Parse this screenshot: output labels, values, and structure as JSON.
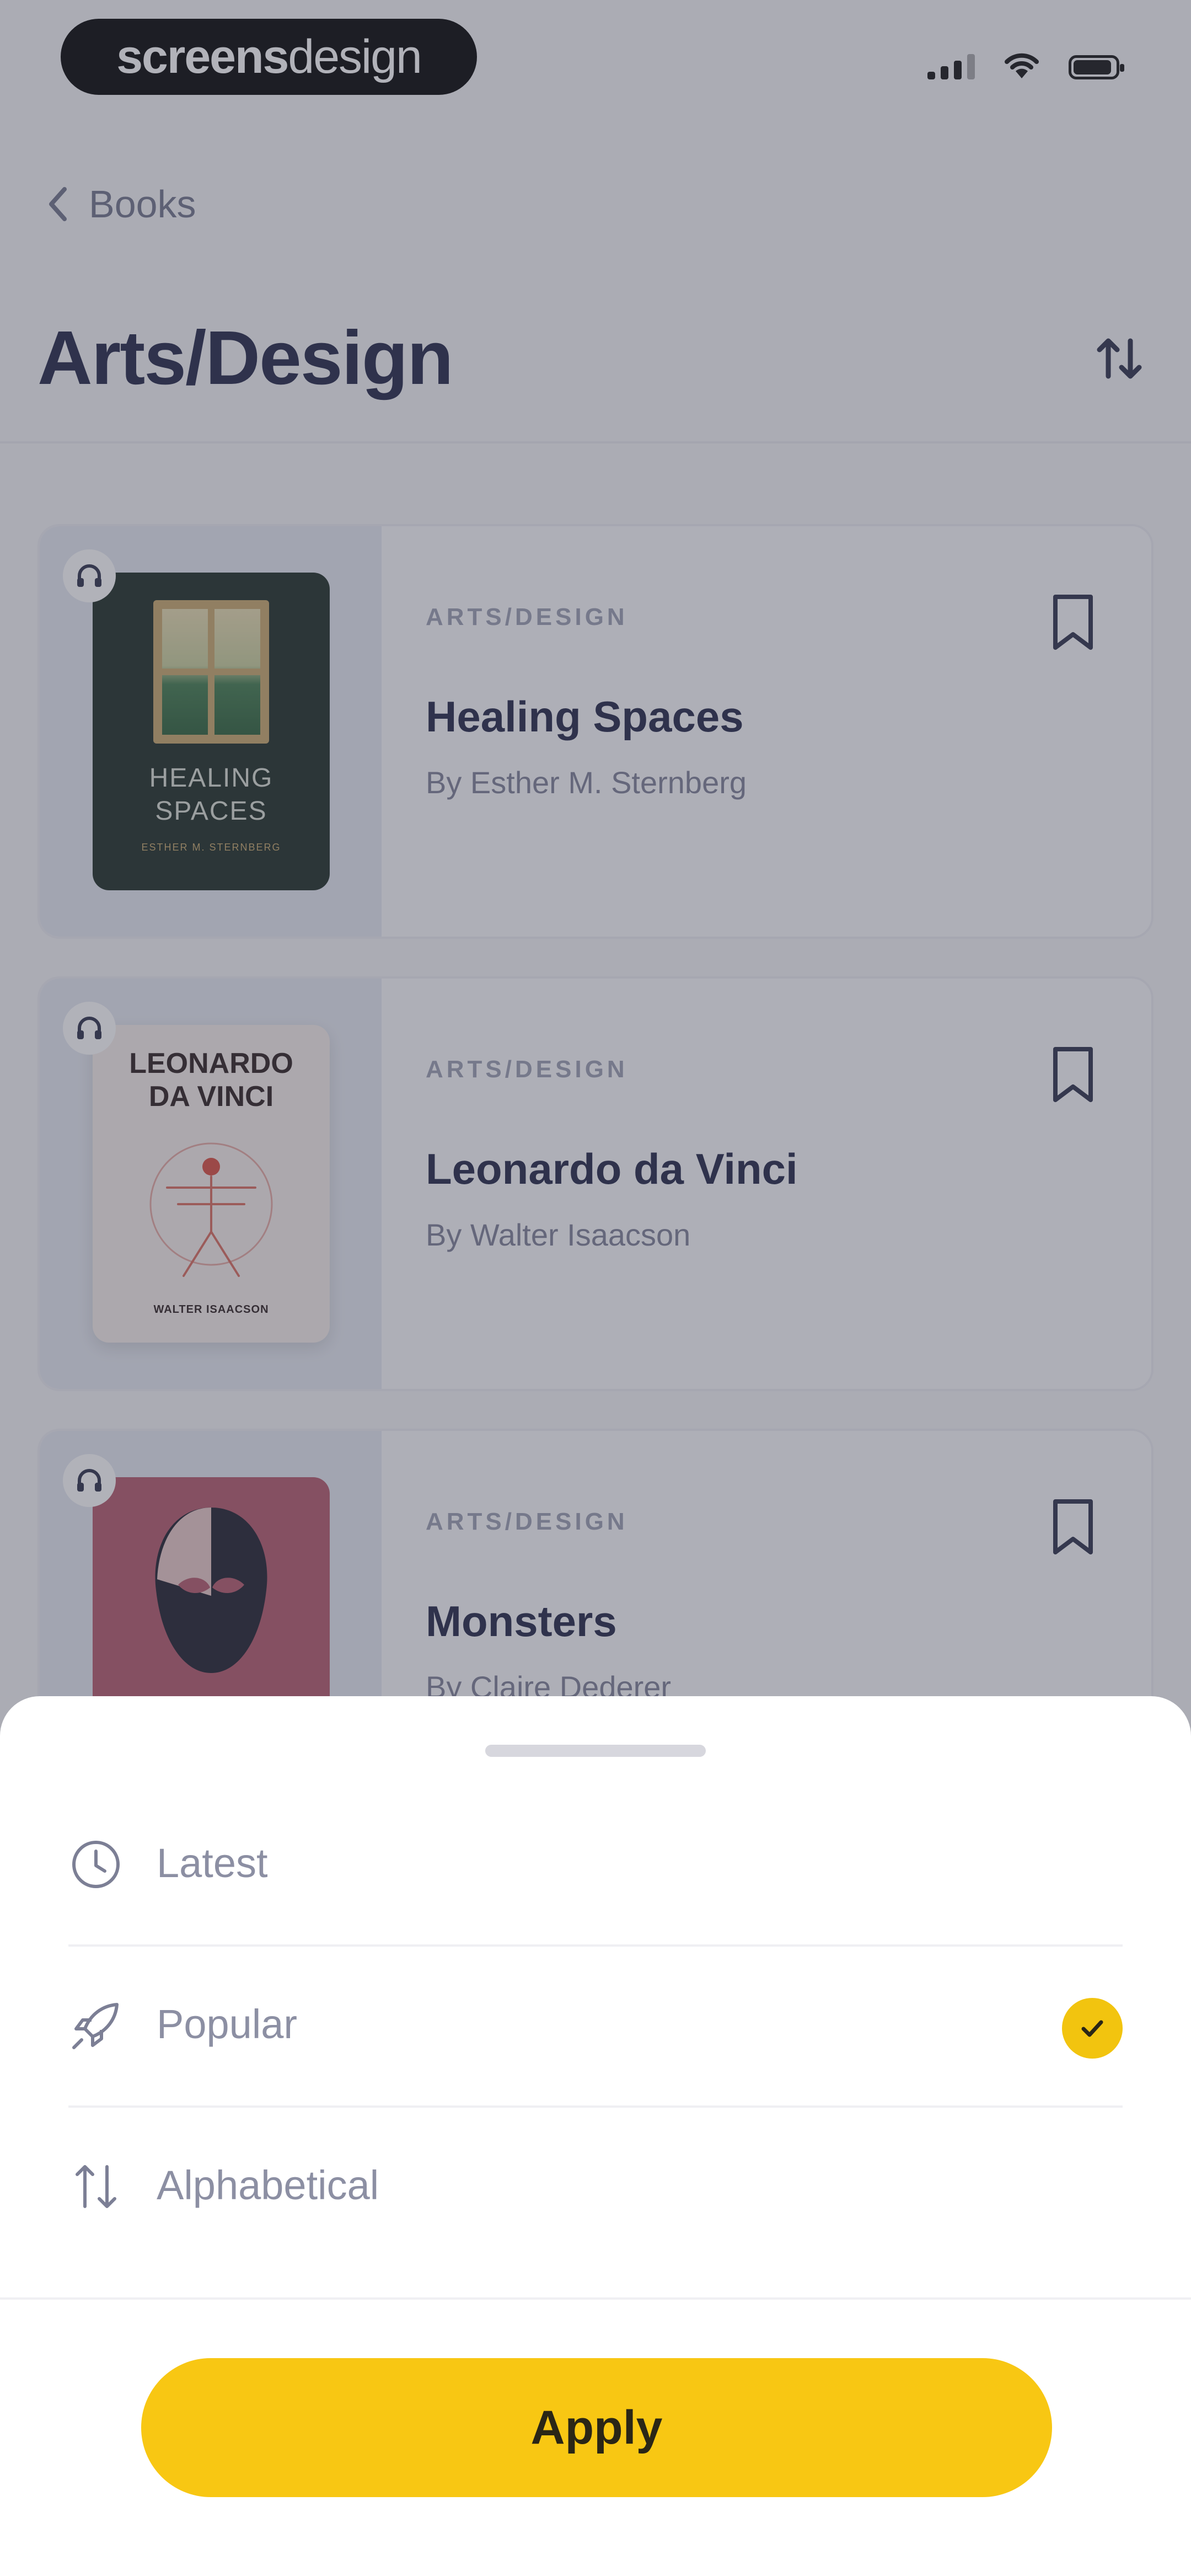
{
  "status_bar": {
    "brand_part1": "screens",
    "brand_part2": "design"
  },
  "nav": {
    "back_label": "Books"
  },
  "page": {
    "title": "Arts/Design"
  },
  "books": [
    {
      "category": "ARTS/DESIGN",
      "title": "Healing Spaces",
      "author": "By Esther M. Sternberg",
      "cover_line1": "HEALING",
      "cover_line2": "SPACES",
      "cover_byline": "ESTHER M. STERNBERG"
    },
    {
      "category": "ARTS/DESIGN",
      "title": "Leonardo da Vinci",
      "author": "By Walter Isaacson",
      "cover_line1": "LEONARDO",
      "cover_line2": "DA VINCI",
      "cover_byline": "WALTER ISAACSON"
    },
    {
      "category": "ARTS/DESIGN",
      "title": "Monsters",
      "author": "By Claire Dederer"
    }
  ],
  "sort_sheet": {
    "options": [
      {
        "label": "Latest",
        "icon": "clock-icon",
        "selected": false
      },
      {
        "label": "Popular",
        "icon": "rocket-icon",
        "selected": true
      },
      {
        "label": "Alphabetical",
        "icon": "sort-arrows-icon",
        "selected": false
      }
    ],
    "apply_label": "Apply"
  },
  "colors": {
    "accent": "#F8C713",
    "title_text": "#1F2444",
    "overlay": "#46485880"
  }
}
